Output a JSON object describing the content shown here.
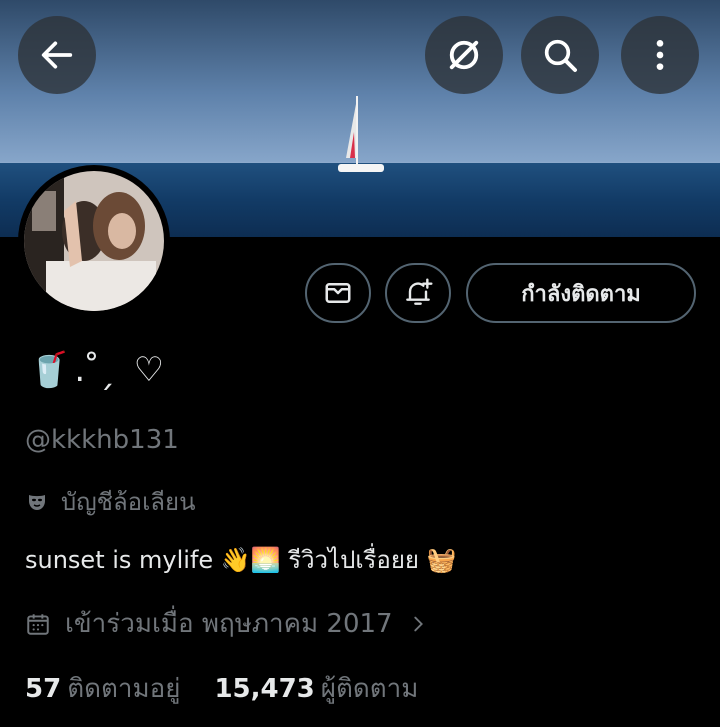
{
  "header": {
    "back_icon": "arrow-left-icon",
    "grok_icon": "grok-icon",
    "search_icon": "search-icon",
    "more_icon": "more-vertical-icon"
  },
  "profile": {
    "display_name": "🥤. ̊ ̗ ♡",
    "handle": "@kkkhb131",
    "parody_label": "บัญชีล้อเลียน",
    "bio": "sunset is mylife 👋🌅 รีวิวไปเรื่อยย 🧺",
    "joined": "เข้าร่วมเมื่อ พฤษภาคม 2017",
    "following_count": "57",
    "following_label": "ติดตามอยู่",
    "followers_count": "15,473",
    "followers_label": "ผู้ติดตาม"
  },
  "actions": {
    "follow_label": "กำลังติดตาม"
  }
}
